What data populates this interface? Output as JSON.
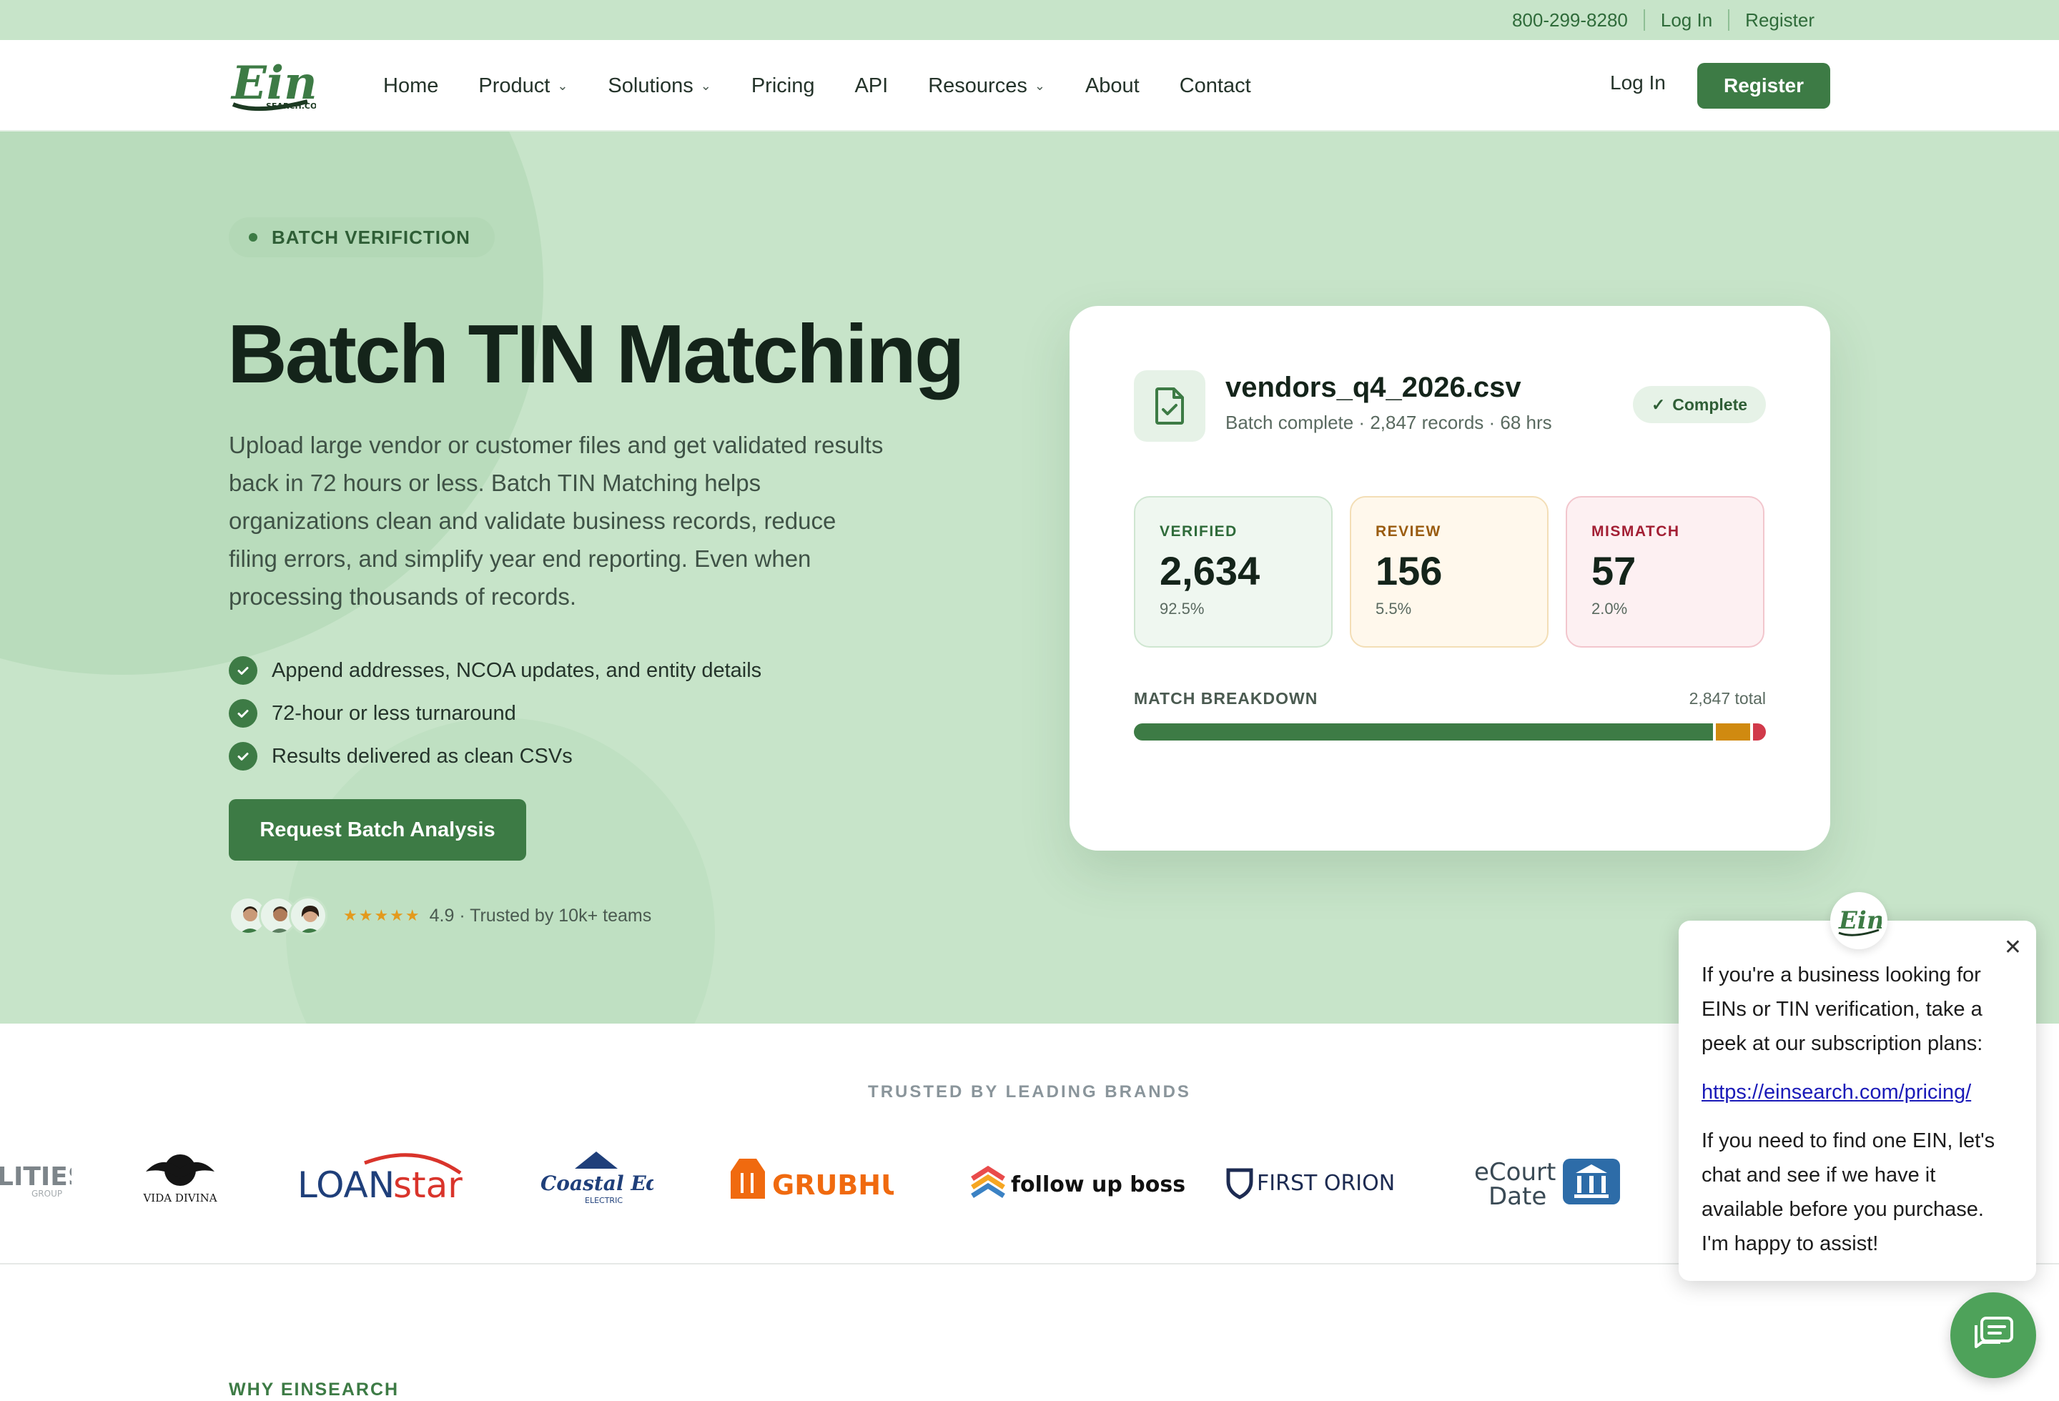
{
  "topbar": {
    "phone": "800-299-8280",
    "login": "Log In",
    "register": "Register"
  },
  "header": {
    "logo_text": "Ein",
    "logo_subtext": "SEARCH.COM",
    "nav": [
      "Home",
      "Product",
      "Solutions",
      "Pricing",
      "API",
      "Resources",
      "About",
      "Contact"
    ],
    "login": "Log In",
    "register": "Register"
  },
  "hero": {
    "badge": "BATCH VERIFICTION",
    "title": "Batch TIN Matching",
    "description": "Upload large vendor or customer files and get validated results back in 72 hours or less. Batch TIN Matching helps organizations clean and validate business records, reduce filing errors, and simplify year end reporting. Even when processing thousands of records.",
    "checks": [
      "Append addresses, NCOA updates, and entity details",
      "72-hour or less turnaround",
      "Results delivered as clean CSVs"
    ],
    "cta": "Request Batch Analysis",
    "stars": "★★★★★",
    "trust": "4.9 · Trusted by 10k+ teams"
  },
  "card": {
    "file_name": "vendors_q4_2026.csv",
    "file_meta": "Batch complete · 2,847 records · 68 hrs",
    "status": "Complete",
    "stats": [
      {
        "label": "VERIFIED",
        "value": "2,634",
        "pct": "92.5%"
      },
      {
        "label": "REVIEW",
        "value": "156",
        "pct": "5.5%"
      },
      {
        "label": "MISMATCH",
        "value": "57",
        "pct": "2.0%"
      }
    ],
    "breakdown_label": "MATCH BREAKDOWN",
    "breakdown_total": "2,847 total",
    "breakdown_fractions": [
      0.925,
      0.055,
      0.02
    ],
    "breakdown_colors": [
      "#3d7b45",
      "#d08a10",
      "#d13a4a"
    ]
  },
  "brands": {
    "title": "TRUSTED BY LEADING BRANDS",
    "items": [
      {
        "name": "LITIES",
        "sub": "GROUP"
      },
      {
        "name": "VIDA DIVINA"
      },
      {
        "name": "LOANstar"
      },
      {
        "name": "Coastal Edge",
        "sub": "ELECTRIC"
      },
      {
        "name": "GRUBHUB"
      },
      {
        "name": "follow up boss"
      },
      {
        "name": "FIRST ORION"
      },
      {
        "name": "eCourt Date"
      }
    ]
  },
  "why": {
    "label": "WHY EINSEARCH"
  },
  "chat": {
    "intro": "If you're a business looking for EINs or TIN verification, take a peek at our subscription plans:",
    "link": "https://einsearch.com/pricing/",
    "help": "If you need to find one EIN, let's chat and see if we have it available before you purchase. I'm happy to assist!"
  },
  "colors": {
    "brand_green": "#3d7b45",
    "hero_bg": "#c7e4c9"
  }
}
